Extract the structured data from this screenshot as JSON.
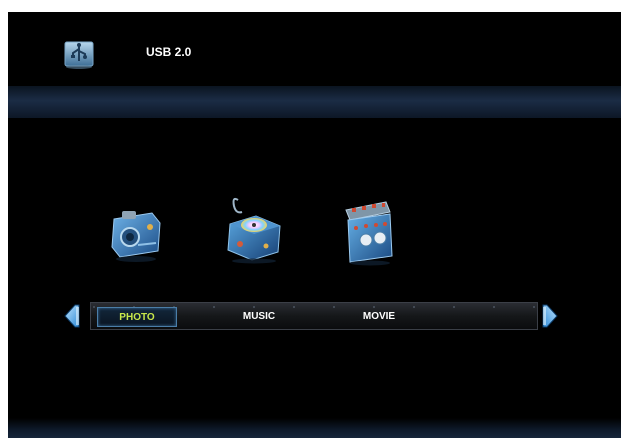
{
  "header": {
    "title": "USB 2.0",
    "source_icon": "usb-drive-icon"
  },
  "categories": [
    {
      "label": "PHOTO",
      "icon": "camera-icon",
      "selected": true
    },
    {
      "label": "MUSIC",
      "icon": "music-box-icon",
      "selected": false
    },
    {
      "label": "MOVIE",
      "icon": "film-clapper-icon",
      "selected": false
    }
  ],
  "nav": {
    "left_arrow_icon": "arrow-left-icon",
    "right_arrow_icon": "arrow-right-icon"
  },
  "colors": {
    "selected_text": "#c8e84a",
    "background": "#000000",
    "accent": "#3a8fd8"
  }
}
